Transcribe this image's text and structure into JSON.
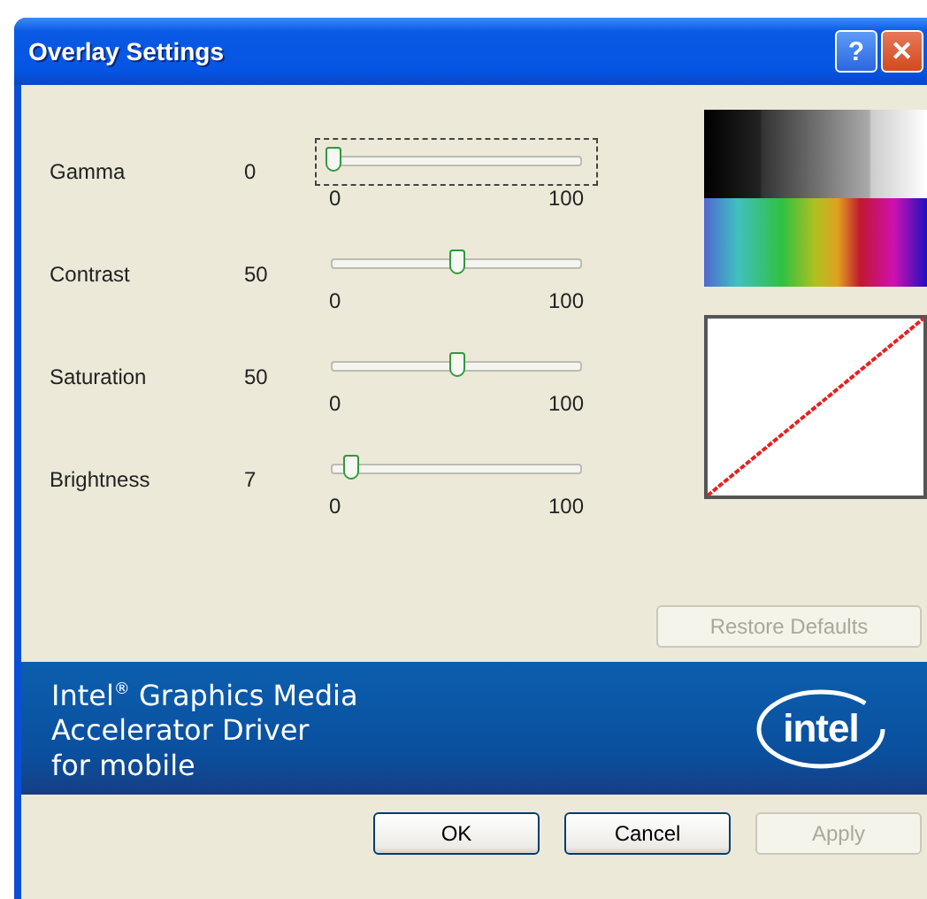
{
  "window": {
    "title": "Overlay Settings",
    "title_buttons": [
      "?",
      "✕"
    ]
  },
  "sliders": [
    {
      "label": "Gamma",
      "value": "0",
      "level": 0,
      "focused": true,
      "min_label": "0",
      "max_label": "100"
    },
    {
      "label": "Contrast",
      "value": "50",
      "level": 0.5,
      "focused": false,
      "min_label": "0",
      "max_label": "100"
    },
    {
      "label": "Saturation",
      "value": "50",
      "level": 0.5,
      "focused": false,
      "min_label": "0",
      "max_label": "100"
    },
    {
      "label": "Brightness",
      "value": "7",
      "level": 0.07,
      "focused": false,
      "min_label": "0",
      "max_label": "100"
    }
  ],
  "restore_button": {
    "label": "Restore Defaults",
    "disabled": true
  },
  "banner": {
    "lines": [
      "Intel$^{®}$ Graphics Media",
      "Accelerator Driver",
      "for mobile"
    ],
    "logo": "intel"
  },
  "buttons": [
    {
      "label": "OK",
      "disabled": false
    },
    {
      "label": "Cancel",
      "disabled": false
    },
    {
      "label": "Apply",
      "disabled": true
    }
  ]
}
